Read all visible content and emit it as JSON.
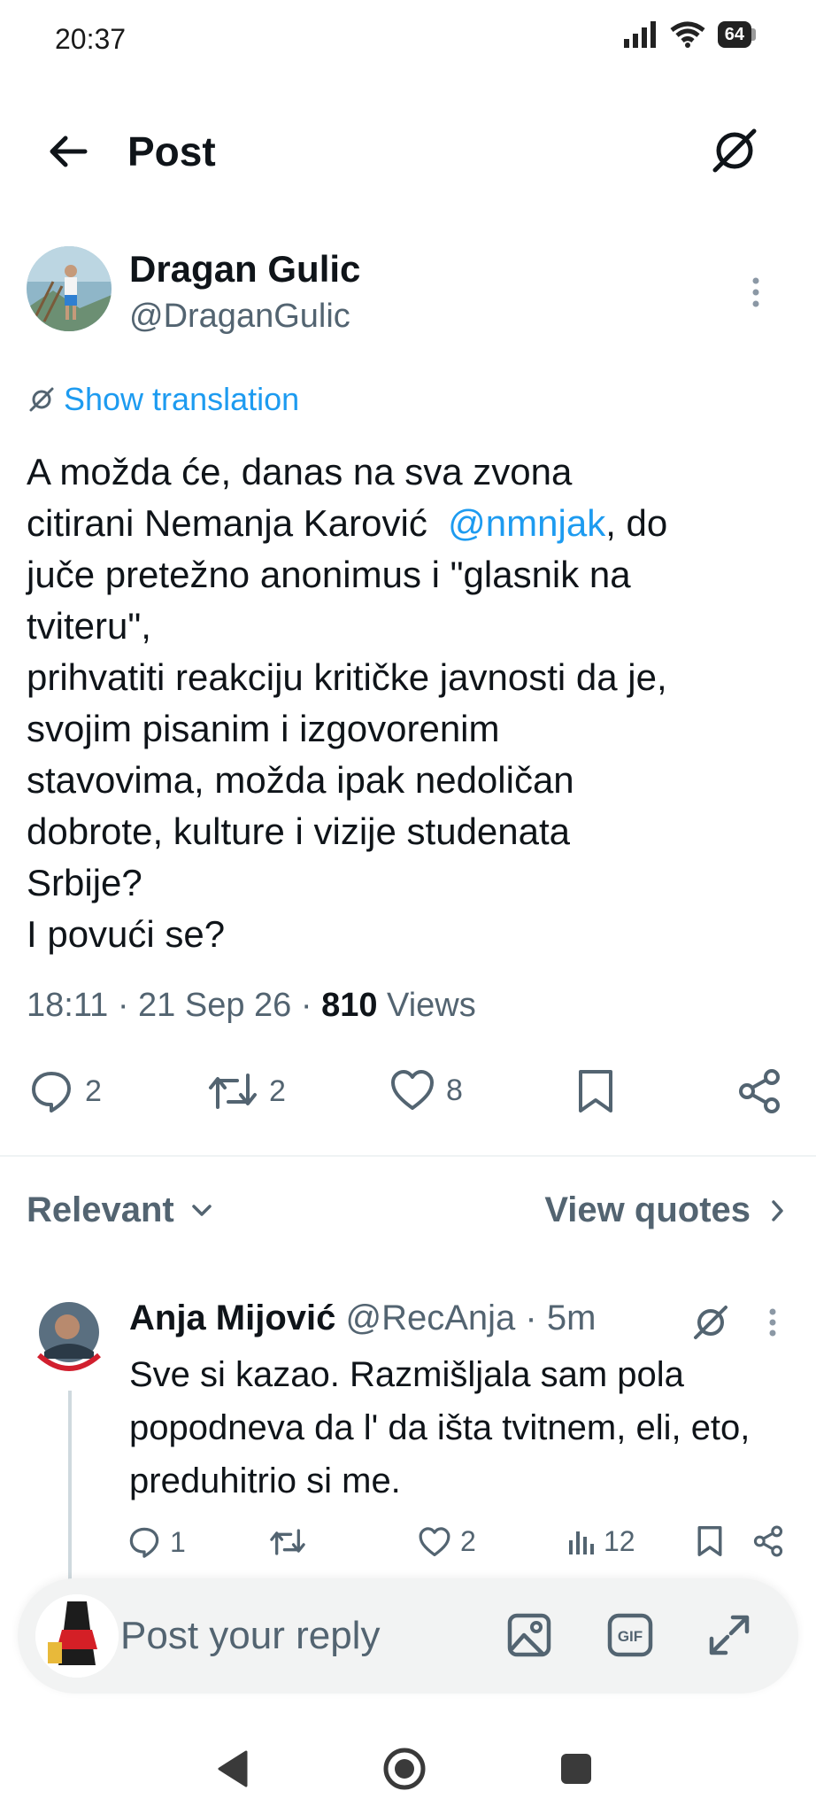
{
  "status_bar": {
    "time": "20:37",
    "battery": "64"
  },
  "header": {
    "title": "Post"
  },
  "post": {
    "author_name": "Dragan Gulic",
    "author_handle": "@DraganGulic",
    "show_translation": "Show translation",
    "text_part1": "A možda će, danas na sva zvona\ncitirani Nemanja Karović  ",
    "mention": "@nmnjak",
    "text_part2": ", do\njuče pretežno anonimus i \"glasnik na\ntviteru\",\nprihvatiti reakciju kritičke javnosti da je,\nsvojim pisanim i izgovorenim\nstavovima, možda ipak nedoličan\ndobrote, kulture i vizije studenata\nSrbije?\nI povući se?",
    "timestamp": "18:11 · 21 Sep 26 · ",
    "views_count": "810",
    "views_label": " Views",
    "replies": "2",
    "reposts": "2",
    "likes": "8"
  },
  "sort": {
    "label": "Relevant",
    "view_quotes": "View quotes"
  },
  "reply": {
    "name": "Anja Mijović",
    "handle": " @RecAnja · 5m",
    "text": "Sve si kazao. Razmišljala sam pola popodneva da l' da išta tvitnem, eli, eto, preduhitrio si me.",
    "replies": "1",
    "reposts": "",
    "likes": "2",
    "views": "12"
  },
  "composer": {
    "placeholder": "Post your reply"
  },
  "colors": {
    "accent": "#1d9bf0",
    "secondary_text": "#536471",
    "primary_text": "#0f1419"
  },
  "icons": [
    "back-arrow-icon",
    "grok-icon",
    "more-vertical-icon",
    "reply-icon",
    "repost-icon",
    "like-icon",
    "bookmark-icon",
    "share-icon",
    "analytics-icon",
    "image-icon",
    "gif-icon",
    "expand-icon"
  ]
}
